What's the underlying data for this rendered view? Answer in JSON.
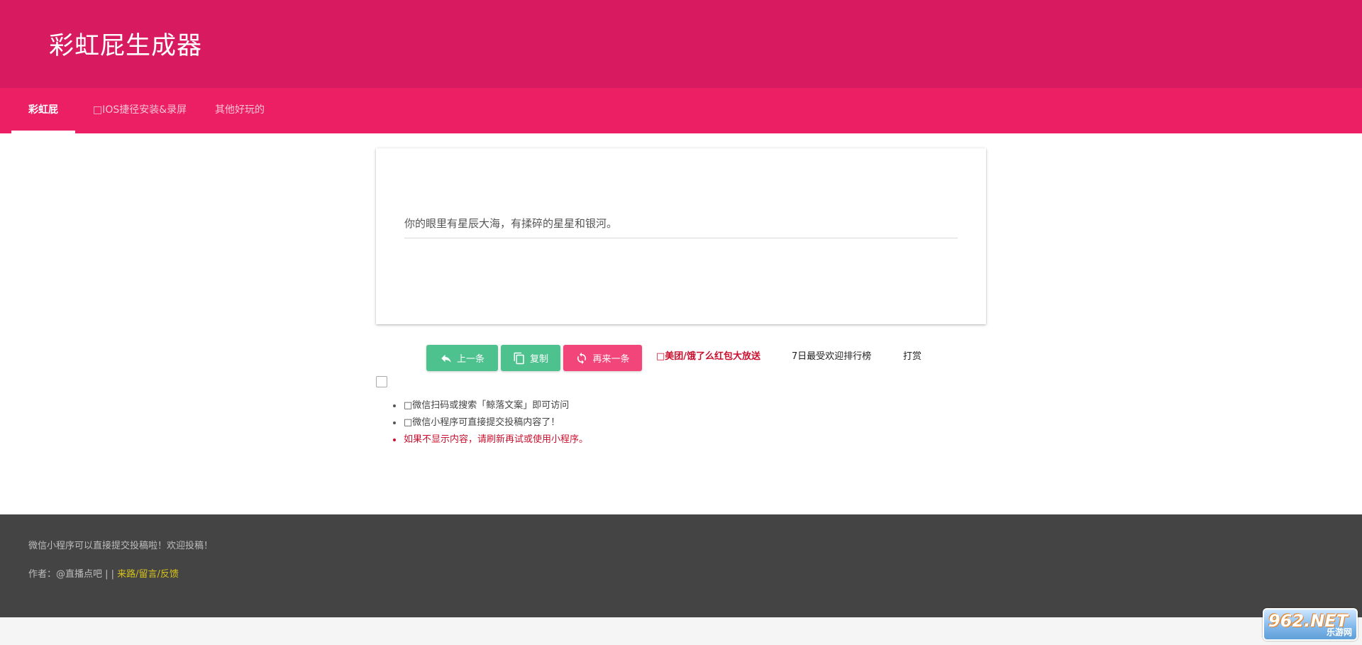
{
  "header": {
    "title": "彩虹屁生成器"
  },
  "tabs": [
    {
      "label": "彩虹屁"
    },
    {
      "label": "□IOS捷径安装&录屏"
    },
    {
      "label": "其他好玩的"
    }
  ],
  "card": {
    "quote": "你的眼里有星辰大海，有揉碎的星星和银河。"
  },
  "actions": {
    "prev": "上一条",
    "copy": "复制",
    "next": "再来一条"
  },
  "links": {
    "promo": "□美团/饿了么红包大放送",
    "ranking": "7日最受欢迎排行榜",
    "tip": "打赏"
  },
  "notes": [
    "□微信扫码或搜索「鲸落文案」即可访问",
    "□微信小程序可直接提交投稿内容了！",
    "如果不显示内容，请刷新再试或使用小程序。"
  ],
  "footer": {
    "message": "微信小程序可以直接提交投稿啦！欢迎投稿！",
    "author_prefix": "作者：@直播点吧 | |",
    "author_link": "来路/留言/反馈"
  },
  "watermark": {
    "top": "962.NET",
    "bottom": "乐游网"
  },
  "colors": {
    "header": "#d81b60",
    "tabbar": "#ec1f64",
    "green_button": "#4ec28e",
    "pink_button": "#f2457a",
    "promo_red": "#c8102e",
    "footer": "#444444"
  }
}
